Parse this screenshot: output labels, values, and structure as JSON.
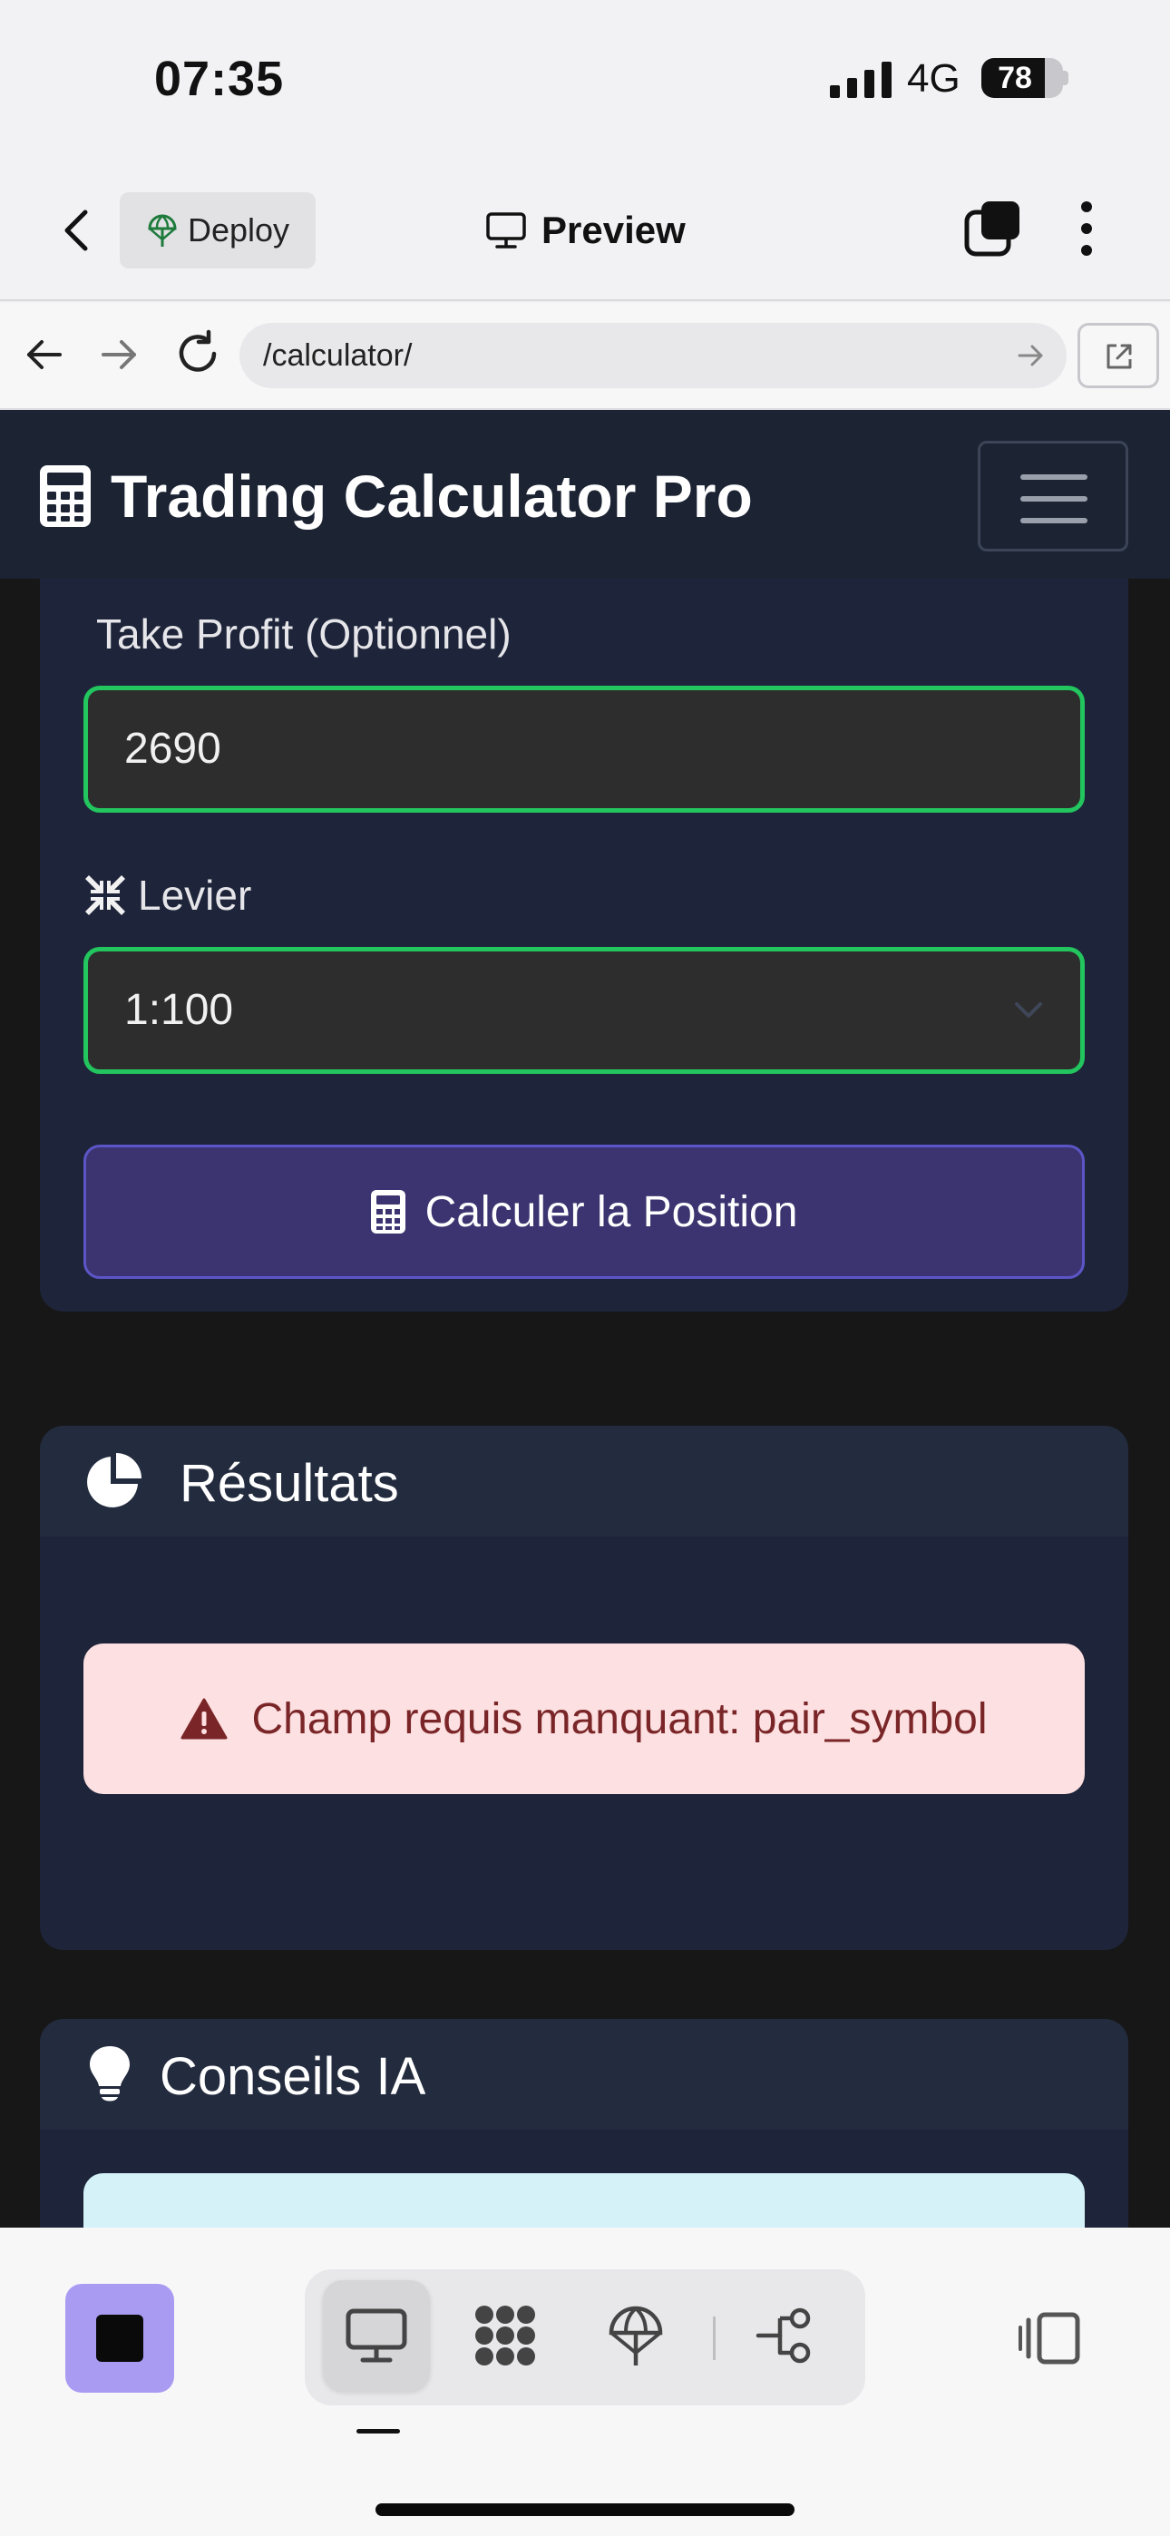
{
  "status": {
    "time": "07:35",
    "network": "4G",
    "battery": "78",
    "battery_level": 0.78
  },
  "toolbar": {
    "deploy_label": "Deploy",
    "preview_label": "Preview"
  },
  "browser": {
    "url": "/calculator/"
  },
  "app": {
    "brand": "Trading Calculator Pro"
  },
  "form": {
    "take_profit_label": "Take Profit (Optionnel)",
    "take_profit_value": "2690",
    "leverage_label": "Levier",
    "leverage_value": "1:100",
    "calc_button": "Calculer la Position"
  },
  "results": {
    "title": "Résultats",
    "error": "Champ requis manquant: pair_symbol"
  },
  "advice": {
    "title": "Conseils IA"
  },
  "colors": {
    "accent_green": "#22c55e",
    "button_purple": "#3c3470",
    "alert_bg": "#fde0e1",
    "navbar": "#1c2333"
  },
  "icons": [
    "chevron-left-icon",
    "globe-icon",
    "monitor-icon",
    "tabs-icon",
    "more-vertical-icon",
    "arrow-left-icon",
    "arrow-right-icon",
    "reload-icon",
    "external-link-icon",
    "calculator-icon",
    "compress-icon",
    "pie-chart-icon",
    "warning-icon",
    "lightbulb-icon",
    "stop-icon",
    "workflow-icon",
    "git-branch-icon",
    "sidebar-icon"
  ]
}
